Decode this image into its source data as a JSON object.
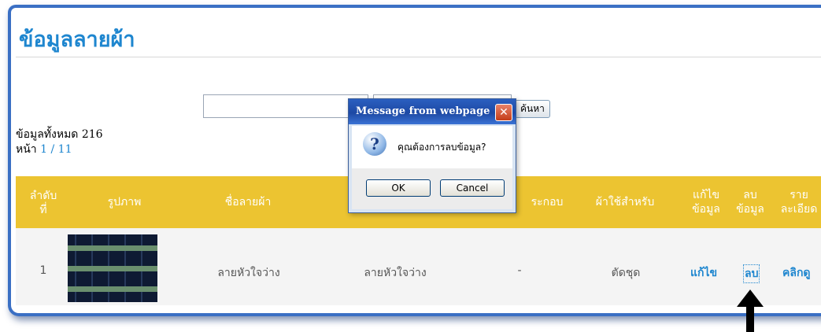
{
  "page": {
    "title": "ข้อมูลลายผ้า",
    "total_label": "ข้อมูลทั้งหมด 216",
    "page_prefix": "หน้า",
    "page_current": "1",
    "page_separator": " / ",
    "page_total": "11"
  },
  "search": {
    "input_value": "",
    "select_value": "",
    "button_label": "ค้นหา"
  },
  "table": {
    "headers": {
      "index_line1": "ลำดับ",
      "index_line2": "ที่",
      "image": "รูปภาพ",
      "name": "ชื่อลายผ้า",
      "component": "ระกอบ",
      "used_for": "ผ้าใช้สำหรับ",
      "edit_line1": "แก้ไข",
      "edit_line2": "ข้อมูล",
      "delete_line1": "ลบ",
      "delete_line2": "ข้อมูล",
      "detail_line1": "ราย",
      "detail_line2": "ละเอียด"
    },
    "rows": [
      {
        "index": "1",
        "name": "ลายหัวใจว่าง",
        "pattern": "ลายหัวใจว่าง",
        "component": "-",
        "used_for": "ตัดชุด",
        "edit_link": "แก้ไข",
        "delete_link": "ลบ",
        "detail_link": "คลิกดู"
      }
    ]
  },
  "dialog": {
    "title": "Message from webpage",
    "close_glyph": "✕",
    "icon_glyph": "?",
    "message": "คุณต้องการลบข้อมูล?",
    "ok_label": "OK",
    "cancel_label": "Cancel"
  },
  "colors": {
    "title_blue": "#1e86cf",
    "header_yellow": "#ecc431",
    "frame_border": "#3a6fc4",
    "dialog_titlebar": "#1d49a4"
  }
}
